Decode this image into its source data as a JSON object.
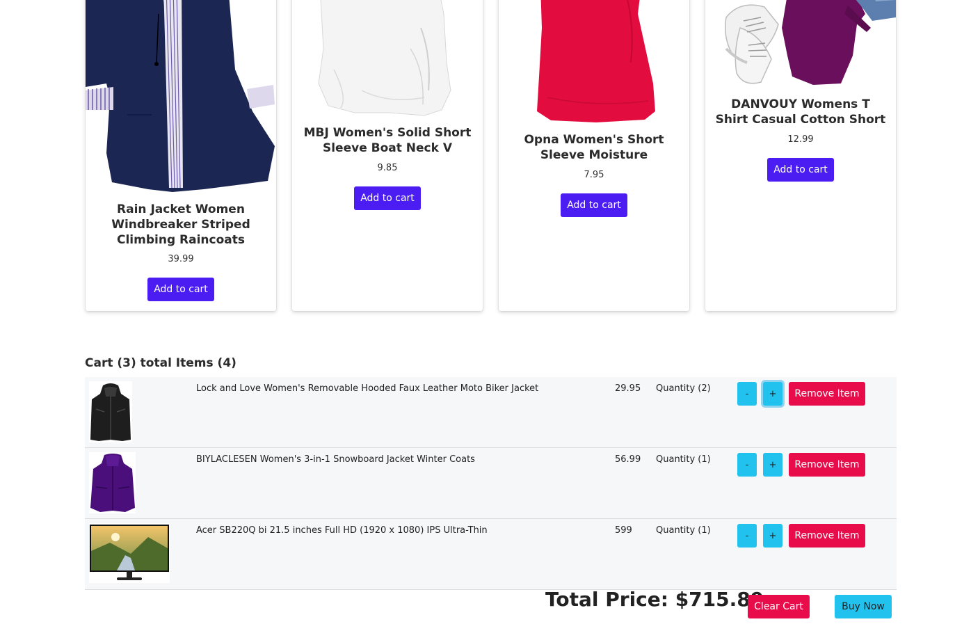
{
  "products": [
    {
      "title": "Rain Jacket Women Windbreaker Striped Climbing Raincoats",
      "price": "39.99",
      "button": "Add to cart",
      "image": "navy-rain-jacket-image"
    },
    {
      "title": "MBJ Women's Solid Short Sleeve Boat Neck V",
      "price": "9.85",
      "button": "Add to cart",
      "image": "white-top-image"
    },
    {
      "title": "Opna Women's Short Sleeve Moisture",
      "price": "7.95",
      "button": "Add to cart",
      "image": "red-tank-top-image"
    },
    {
      "title": "DANVOUY Womens T Shirt Casual Cotton Short",
      "price": "12.99",
      "button": "Add to cart",
      "image": "purple-tshirt-sneakers-image"
    }
  ],
  "cart": {
    "heading": "Cart (3) total Items (4)",
    "items": [
      {
        "name": "Lock and Love Women's Removable Hooded Faux Leather Moto Biker Jacket",
        "price": "29.95",
        "quantity": "Quantity (2)",
        "minus": "-",
        "plus": "+",
        "remove": "Remove Item",
        "image": "black-leather-jacket-image"
      },
      {
        "name": "BIYLACLESEN Women's 3-in-1 Snowboard Jacket Winter Coats",
        "price": "56.99",
        "quantity": "Quantity (1)",
        "minus": "-",
        "plus": "+",
        "remove": "Remove Item",
        "image": "purple-winter-coat-image"
      },
      {
        "name": "Acer SB220Q bi 21.5 inches Full HD (1920 x 1080) IPS Ultra-Thin",
        "price": "599",
        "quantity": "Quantity (1)",
        "minus": "-",
        "plus": "+",
        "remove": "Remove Item",
        "image": "monitor-image"
      }
    ],
    "total": "Total Price: $715.89",
    "clear_label": "Clear Cart",
    "buy_label": "Buy Now"
  },
  "colors": {
    "add_button": "#4b1df2",
    "danger": "#e90c4a",
    "info": "#22c2ef"
  }
}
